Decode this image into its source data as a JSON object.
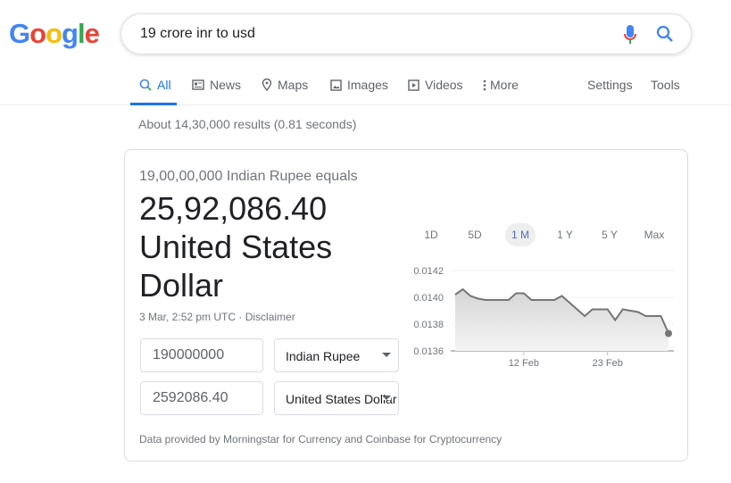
{
  "logo": {
    "text": "Google",
    "colors": [
      "#4285f4",
      "#ea4335",
      "#fbbc05",
      "#4285f4",
      "#34a853",
      "#ea4335"
    ]
  },
  "search": {
    "query": "19 crore inr to usd",
    "icons": [
      "mic-icon",
      "search-icon"
    ]
  },
  "tabs": [
    {
      "label": "All",
      "icon": "search-icon",
      "active": true
    },
    {
      "label": "News",
      "icon": "news-icon"
    },
    {
      "label": "Maps",
      "icon": "pin-icon"
    },
    {
      "label": "Images",
      "icon": "image-icon"
    },
    {
      "label": "Videos",
      "icon": "play-icon"
    },
    {
      "label": "More",
      "icon": "more-vert-icon"
    }
  ],
  "tools": {
    "settings": "Settings",
    "tools": "Tools"
  },
  "stats": "About 14,30,000 results (0.81 seconds)",
  "converter": {
    "equals": "19,00,00,000 Indian Rupee equals",
    "result": "25,92,086.40 United States Dollar",
    "timestamp": "3 Mar, 2:52 pm UTC · Disclaimer",
    "from_value": "190000000",
    "from_currency": "Indian Rupee",
    "to_value": "2592086.40",
    "to_currency": "United States Dollar",
    "source": "Data provided by Morningstar for Currency and Coinbase for Cryptocurrency",
    "ranges": [
      "1D",
      "5D",
      "1 M",
      "1 Y",
      "5 Y",
      "Max"
    ],
    "active_range": "1 M"
  },
  "chart_data": {
    "type": "area",
    "x": [
      "3 Feb",
      "4 Feb",
      "5 Feb",
      "6 Feb",
      "7 Feb",
      "10 Feb",
      "11 Feb",
      "12 Feb",
      "13 Feb",
      "16 Feb",
      "17 Feb",
      "18 Feb",
      "20 Feb",
      "21 Feb",
      "23 Feb",
      "24 Feb",
      "25 Feb",
      "26 Feb",
      "27 Feb",
      "28 Feb",
      "2 Mar",
      "3 Mar"
    ],
    "values": [
      0.01402,
      0.01406,
      0.01401,
      0.01399,
      0.01398,
      0.01398,
      0.01403,
      0.01403,
      0.01398,
      0.01398,
      0.01401,
      0.01396,
      0.01386,
      0.01391,
      0.01391,
      0.01383,
      0.01391,
      0.0139,
      0.01389,
      0.01386,
      0.01386,
      0.01373
    ],
    "yticks": [
      "0.0142",
      "0.0140",
      "0.0138",
      "0.0136"
    ],
    "ylim": [
      0.0136,
      0.0142
    ],
    "xticks": [
      "12 Feb",
      "23 Feb"
    ],
    "grid": true,
    "line_color": "#757575"
  }
}
